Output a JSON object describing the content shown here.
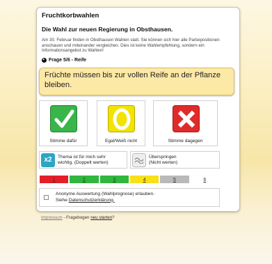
{
  "app": {
    "title": "Fruchtkorbwahlen"
  },
  "heading": "Die Wahl zur neuen Regierung in Obsthausen.",
  "intro": "Am 30. Februar finden in Obsthausen Wahlen statt. Sie können sich hier alle Parteipositionen anschauen und miteinander vergleichen. Dies ist keine Wahlempfehlung, sondern ein Informationsangebot zu Wahlen!",
  "question": {
    "label": "Frage 5/6 - Reife",
    "progress": 0.8333,
    "thesis": "Früchte müssen bis zur vollen Reife an der Pflanze bleiben."
  },
  "answers": {
    "agree": {
      "label": "Stimme dafür",
      "icon": "checkmark-icon",
      "color": "#39b54a"
    },
    "neutral": {
      "label": "Egal/Weiß nicht",
      "icon": "circle-icon",
      "color": "#f2e300"
    },
    "disagree": {
      "label": "Stimme dagegen",
      "icon": "cross-icon",
      "color": "#e02b2b"
    }
  },
  "options": {
    "double": {
      "badge": "x2",
      "label_line1": "Thema ist für mich sehr",
      "label_line2": "wichtig. (Doppelt werten)"
    },
    "skip": {
      "label_line1": "Überspringen",
      "label_line2": "(Nicht werten)",
      "icon": "skip-arrows-icon"
    }
  },
  "progress_scale": [
    {
      "label": "1",
      "color": "#e41e26"
    },
    {
      "label": "2",
      "color": "#31b63f"
    },
    {
      "label": "3",
      "color": "#31b63f"
    },
    {
      "label": "4",
      "color": "#f9e01a"
    },
    {
      "label": "5",
      "color": "#b9b9b9"
    },
    {
      "label": "6",
      "color": "#ffffff"
    }
  ],
  "consent": {
    "text": "Anonyme Auswertung (Wahlprognose) erlauben.",
    "see": "Siehe ",
    "link": "Datenschutzerklärung."
  },
  "footer": {
    "impressum": "Impressum",
    "separator": " - Fragebogen ",
    "restart": "neu starten",
    "end": "?"
  }
}
